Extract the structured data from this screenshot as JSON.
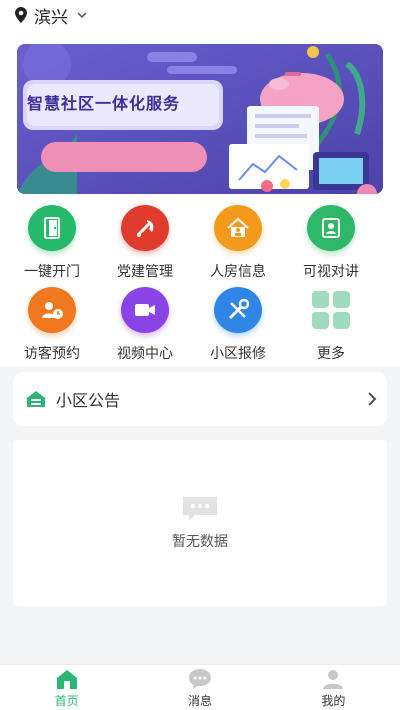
{
  "header": {
    "city": "滨兴"
  },
  "banner": {
    "title": "智慧社区一体化服务",
    "dots": 3,
    "active_dot": 0
  },
  "grid": [
    {
      "label": "一键开门",
      "icon": "door-icon",
      "color": "#26b86b"
    },
    {
      "label": "党建管理",
      "icon": "party-emblem-icon",
      "color": "#e13b2e"
    },
    {
      "label": "人房信息",
      "icon": "house-person-icon",
      "color": "#f39a1c"
    },
    {
      "label": "可视对讲",
      "icon": "video-intercom-icon",
      "color": "#2fb86a"
    },
    {
      "label": "访客预约",
      "icon": "visitor-clock-icon",
      "color": "#f0781e"
    },
    {
      "label": "视频中心",
      "icon": "video-camera-icon",
      "color": "#8a44e6"
    },
    {
      "label": "小区报修",
      "icon": "repair-tools-icon",
      "color": "#2f86e6"
    },
    {
      "label": "更多",
      "icon": "more-grid-icon",
      "color": "#9fdcbd"
    }
  ],
  "notice": {
    "label": "小区公告"
  },
  "empty": {
    "text": "暂无数据"
  },
  "tabbar": [
    {
      "label": "首页",
      "icon": "home-icon",
      "active": true
    },
    {
      "label": "消息",
      "icon": "message-icon",
      "active": false
    },
    {
      "label": "我的",
      "icon": "profile-icon",
      "active": false
    }
  ],
  "colors": {
    "accent": "#2bb673",
    "inactive_icon": "#c8c8c8"
  }
}
